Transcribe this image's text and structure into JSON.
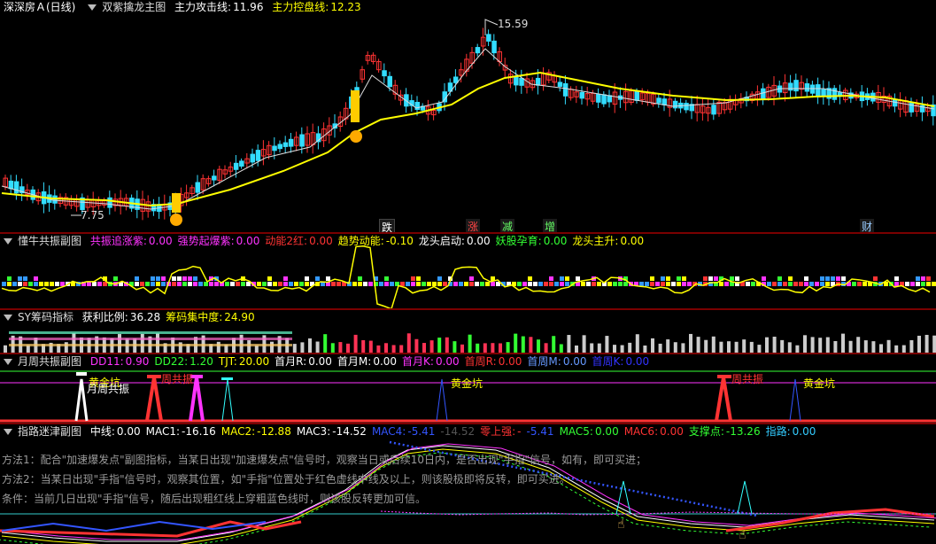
{
  "main": {
    "stock": "深深房Ａ(日线)",
    "indicator": "双紫擒龙主图",
    "attack_label": "主力攻击线:",
    "attack_value": "11.96",
    "control_label": "主力控盘线:",
    "control_value": "12.23",
    "high_label": "15.59",
    "low_label": "7.75",
    "events": [
      "跌",
      "涨",
      "减",
      "增",
      "财"
    ]
  },
  "p1": {
    "title": "懂牛共振副图",
    "items": [
      {
        "label": "共振追涨紫:",
        "value": "0.00",
        "color": "#ff33ff"
      },
      {
        "label": "强势起爆紫:",
        "value": "0.00",
        "color": "#ff33ff"
      },
      {
        "label": "动能2红:",
        "value": "0.00",
        "color": "#ff3333"
      },
      {
        "label": "趋势动能:",
        "value": "-0.10",
        "color": "#ffff00"
      },
      {
        "label": "龙头启动:",
        "value": "0.00",
        "color": "#ffffff"
      },
      {
        "label": "妖股孕育:",
        "value": "0.00",
        "color": "#33ff33"
      },
      {
        "label": "龙头主升:",
        "value": "0.00",
        "color": "#ffff00"
      }
    ]
  },
  "p2": {
    "title": "SY筹码指标",
    "items": [
      {
        "label": "获利比例:",
        "value": "36.28",
        "color": "#ffffff"
      },
      {
        "label": "筹码集中度:",
        "value": "24.90",
        "color": "#ffff00"
      }
    ]
  },
  "p3": {
    "title": "月周共振副图",
    "items": [
      {
        "label": "DD11:",
        "value": "0.90",
        "color": "#ff33ff"
      },
      {
        "label": "DD22:",
        "value": "1.20",
        "color": "#33ff33"
      },
      {
        "label": "TJT:",
        "value": "20.00",
        "color": "#ffff00"
      },
      {
        "label": "首月R:",
        "value": "0.00",
        "color": "#ffffff"
      },
      {
        "label": "首月M:",
        "value": "0.00",
        "color": "#ffffff"
      },
      {
        "label": "首月K:",
        "value": "0.00",
        "color": "#ff33ff"
      },
      {
        "label": "首周R:",
        "value": "0.00",
        "color": "#ff3333"
      },
      {
        "label": "首周M:",
        "value": "0.00",
        "color": "#6699ff"
      },
      {
        "label": "首周K:",
        "value": "0.00",
        "color": "#3333ff"
      }
    ],
    "labels": {
      "gold": "黄金坑",
      "week": "周共振",
      "monthweek": "月周共振"
    }
  },
  "p4": {
    "title": "指路迷津副图",
    "items": [
      {
        "label": "中线:",
        "value": "0.00",
        "color": "#ffffff"
      },
      {
        "label": "MAC1:",
        "value": "-16.16",
        "color": "#ffffff"
      },
      {
        "label": "MAC2:",
        "value": "-12.88",
        "color": "#ffff00"
      },
      {
        "label": "MAC3:",
        "value": "-14.52",
        "color": "#ffffff"
      },
      {
        "label": "MAC4:",
        "value": "-5.41",
        "color": "#3355ff"
      },
      {
        "label": "",
        "value": "-14.52",
        "color": "#555555"
      },
      {
        "label": "零上强:",
        "value": "-",
        "color": "#ff3333"
      },
      {
        "label": "",
        "value": "-5.41",
        "color": "#3355ff"
      },
      {
        "label": "MAC5:",
        "value": "0.00",
        "color": "#33ff33"
      },
      {
        "label": "MAC6:",
        "value": "0.00",
        "color": "#ff3333"
      },
      {
        "label": "支撑点:",
        "value": "-13.26",
        "color": "#33ff33"
      },
      {
        "label": "指路:",
        "value": "0.00",
        "color": "#33ccff"
      }
    ],
    "method1": "方法1：配合\"加速爆发点\"副图指标，当某日出现\"加速爆发点\"信号时，观察当日或后续10日内，是否出现\"手指\"信号，如有，即可买进；",
    "method2": "方法2：当某日出现\"手指\"信号时，观察其位置，如\"手指\"位置处于红色虚线中线及以上，则该股极即将反转，即可买进。",
    "condition": "条件：当前几日出现\"手指\"信号，随后出现粗红线上穿粗蓝色线时，则该股反转更加可信。"
  }
}
